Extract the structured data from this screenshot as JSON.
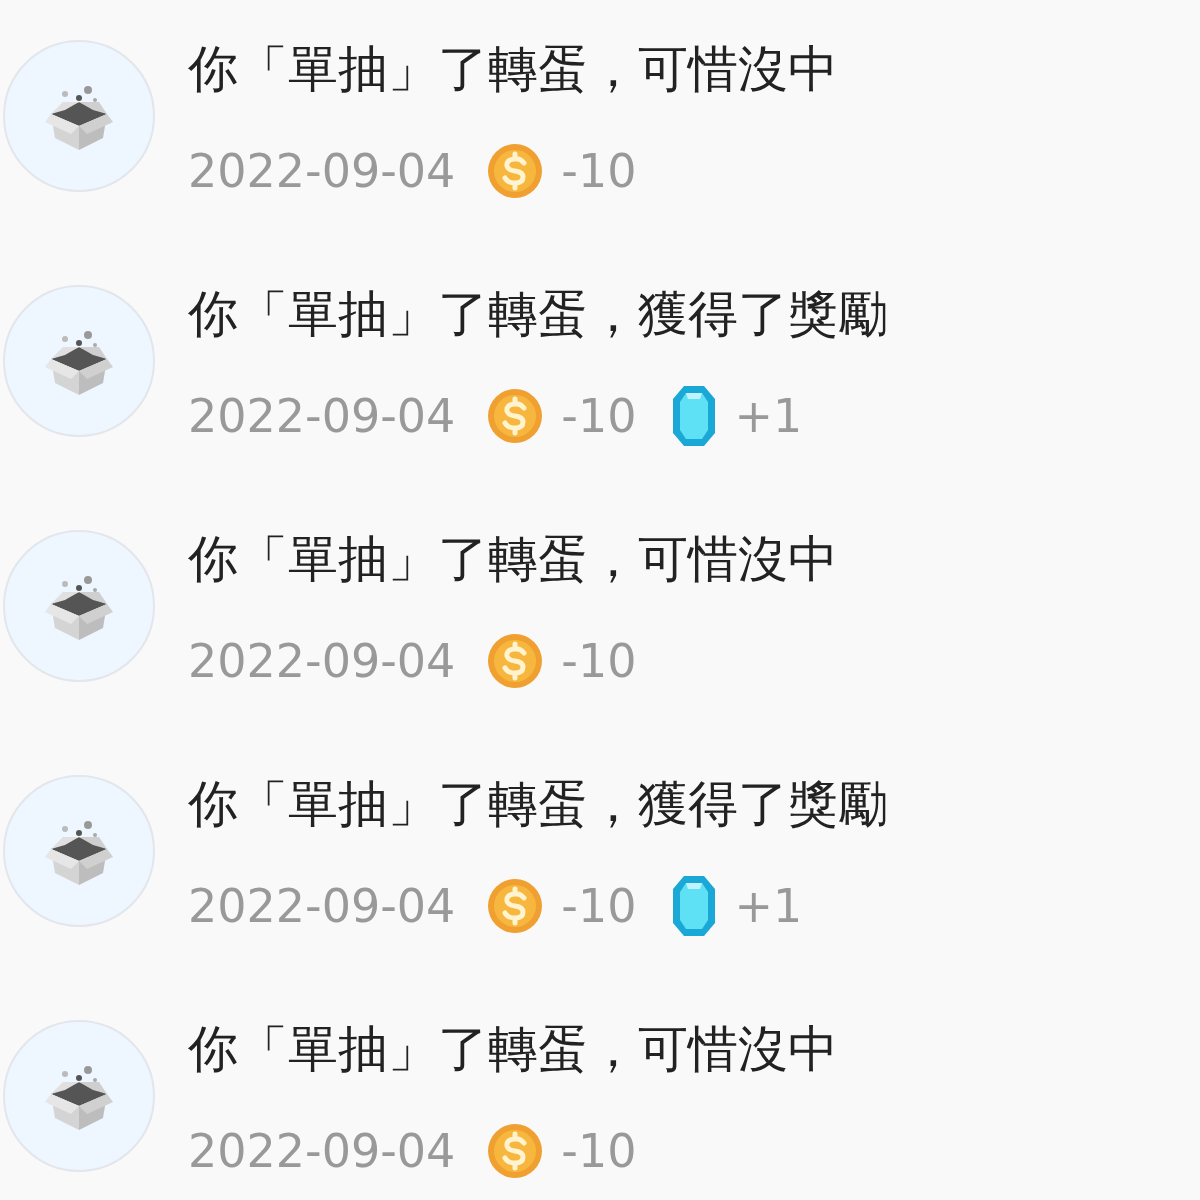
{
  "records": [
    {
      "title": "你「單抽」了轉蛋，可惜沒中",
      "date": "2022-09-04",
      "rewards": [
        {
          "kind": "coin",
          "amount": "-10"
        }
      ]
    },
    {
      "title": "你「單抽」了轉蛋，獲得了獎勵",
      "date": "2022-09-04",
      "rewards": [
        {
          "kind": "coin",
          "amount": "-10"
        },
        {
          "kind": "gem",
          "amount": "+1"
        }
      ]
    },
    {
      "title": "你「單抽」了轉蛋，可惜沒中",
      "date": "2022-09-04",
      "rewards": [
        {
          "kind": "coin",
          "amount": "-10"
        }
      ]
    },
    {
      "title": "你「單抽」了轉蛋，獲得了獎勵",
      "date": "2022-09-04",
      "rewards": [
        {
          "kind": "coin",
          "amount": "-10"
        },
        {
          "kind": "gem",
          "amount": "+1"
        }
      ]
    },
    {
      "title": "你「單抽」了轉蛋，可惜沒中",
      "date": "2022-09-04",
      "rewards": [
        {
          "kind": "coin",
          "amount": "-10"
        }
      ]
    }
  ]
}
